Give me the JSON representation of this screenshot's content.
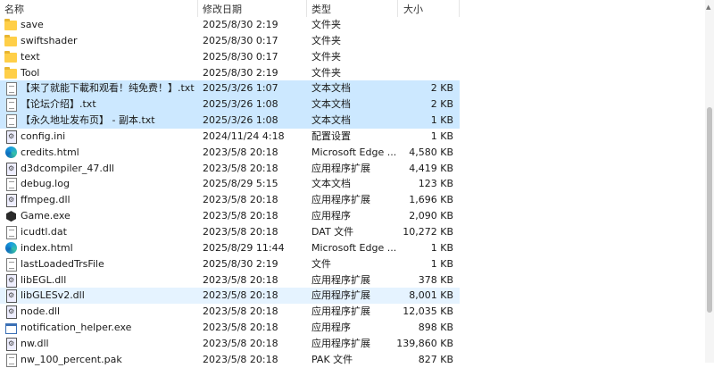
{
  "header": {
    "name": "名称",
    "date": "修改日期",
    "type": "类型",
    "size": "大小"
  },
  "files": [
    {
      "name": "save",
      "date": "2025/8/30 2:19",
      "type": "文件夹",
      "size": "",
      "icon": "folder-icon",
      "state": ""
    },
    {
      "name": "swiftshader",
      "date": "2025/8/30 0:17",
      "type": "文件夹",
      "size": "",
      "icon": "folder-icon",
      "state": ""
    },
    {
      "name": "text",
      "date": "2025/8/30 0:17",
      "type": "文件夹",
      "size": "",
      "icon": "folder-icon",
      "state": ""
    },
    {
      "name": "Tool",
      "date": "2025/8/30 2:19",
      "type": "文件夹",
      "size": "",
      "icon": "folder-icon",
      "state": ""
    },
    {
      "name": "【来了就能下載和观看！纯免费！】.txt",
      "date": "2025/3/26 1:07",
      "type": "文本文档",
      "size": "2 KB",
      "icon": "text-file-icon",
      "state": "selected"
    },
    {
      "name": "【论坛介绍】.txt",
      "date": "2025/3/26 1:08",
      "type": "文本文档",
      "size": "2 KB",
      "icon": "text-file-icon",
      "state": "selected"
    },
    {
      "name": "【永久地址发布页】 - 副本.txt",
      "date": "2025/3/26 1:08",
      "type": "文本文档",
      "size": "1 KB",
      "icon": "text-file-icon",
      "state": "selected"
    },
    {
      "name": "config.ini",
      "date": "2024/11/24 4:18",
      "type": "配置设置",
      "size": "1 KB",
      "icon": "settings-file-icon",
      "state": ""
    },
    {
      "name": "credits.html",
      "date": "2023/5/8 20:18",
      "type": "Microsoft Edge ...",
      "size": "4,580 KB",
      "icon": "edge-icon",
      "state": ""
    },
    {
      "name": "d3dcompiler_47.dll",
      "date": "2023/5/8 20:18",
      "type": "应用程序扩展",
      "size": "4,419 KB",
      "icon": "dll-file-icon",
      "state": ""
    },
    {
      "name": "debug.log",
      "date": "2025/8/29 5:15",
      "type": "文本文档",
      "size": "123 KB",
      "icon": "text-file-icon",
      "state": ""
    },
    {
      "name": "ffmpeg.dll",
      "date": "2023/5/8 20:18",
      "type": "应用程序扩展",
      "size": "1,696 KB",
      "icon": "dll-file-icon",
      "state": ""
    },
    {
      "name": "Game.exe",
      "date": "2023/5/8 20:18",
      "type": "应用程序",
      "size": "2,090 KB",
      "icon": "game-exe-icon",
      "state": ""
    },
    {
      "name": "icudtl.dat",
      "date": "2023/5/8 20:18",
      "type": "DAT 文件",
      "size": "10,272 KB",
      "icon": "file-icon",
      "state": ""
    },
    {
      "name": "index.html",
      "date": "2025/8/29 11:44",
      "type": "Microsoft Edge ...",
      "size": "1 KB",
      "icon": "edge-icon",
      "state": ""
    },
    {
      "name": "lastLoadedTrsFile",
      "date": "2025/8/30 2:19",
      "type": "文件",
      "size": "1 KB",
      "icon": "file-icon",
      "state": ""
    },
    {
      "name": "libEGL.dll",
      "date": "2023/5/8 20:18",
      "type": "应用程序扩展",
      "size": "378 KB",
      "icon": "dll-file-icon",
      "state": ""
    },
    {
      "name": "libGLESv2.dll",
      "date": "2023/5/8 20:18",
      "type": "应用程序扩展",
      "size": "8,001 KB",
      "icon": "dll-file-icon",
      "state": "hover"
    },
    {
      "name": "node.dll",
      "date": "2023/5/8 20:18",
      "type": "应用程序扩展",
      "size": "12,035 KB",
      "icon": "dll-file-icon",
      "state": ""
    },
    {
      "name": "notification_helper.exe",
      "date": "2023/5/8 20:18",
      "type": "应用程序",
      "size": "898 KB",
      "icon": "exe-window-icon",
      "state": ""
    },
    {
      "name": "nw.dll",
      "date": "2023/5/8 20:18",
      "type": "应用程序扩展",
      "size": "139,860 KB",
      "icon": "dll-file-icon",
      "state": ""
    },
    {
      "name": "nw_100_percent.pak",
      "date": "2023/5/8 20:18",
      "type": "PAK 文件",
      "size": "827 KB",
      "icon": "file-icon",
      "state": ""
    }
  ],
  "colors": {
    "selected": "#cce8ff",
    "hover": "#e5f3ff",
    "folder": "#ffcf48"
  }
}
